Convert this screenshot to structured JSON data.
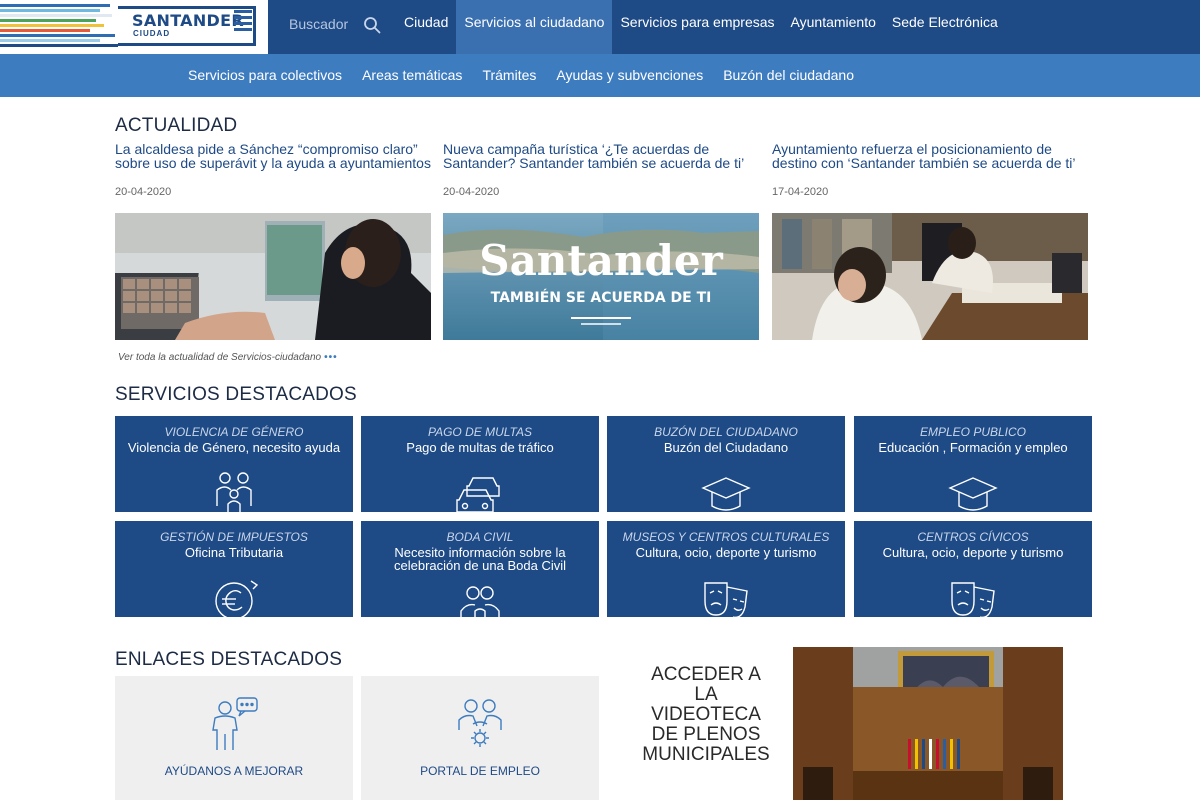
{
  "logo": {
    "name": "SANTANDER",
    "sub": "CIUDAD"
  },
  "search": {
    "label": "Buscador"
  },
  "mainnav": [
    {
      "label": "Ciudad"
    },
    {
      "label": "Servicios al ciudadano"
    },
    {
      "label": "Servicios para empresas"
    },
    {
      "label": "Ayuntamiento"
    },
    {
      "label": "Sede Electrónica"
    }
  ],
  "subnav": [
    {
      "label": "Servicios para colectivos"
    },
    {
      "label": "Areas temáticas"
    },
    {
      "label": "Trámites"
    },
    {
      "label": "Ayudas y subvenciones"
    },
    {
      "label": "Buzón del ciudadano"
    }
  ],
  "actualidad": {
    "title": "ACTUALIDAD",
    "items": [
      {
        "title": "La alcaldesa pide a Sánchez “compromiso claro” sobre uso de superávit y la ayuda a ayuntamientos",
        "date": "20-04-2020"
      },
      {
        "title": "Nueva campaña turística ‘¿Te acuerdas de Santander? Santander también se acuerda de ti’",
        "date": "20-04-2020",
        "img_title": "Santander",
        "img_sub": "TAMBIÉN SE ACUERDA DE TI"
      },
      {
        "title": "Ayuntamiento refuerza el posicionamiento de destino con ‘Santander también se acuerda de ti’",
        "date": "17-04-2020"
      }
    ],
    "see_all": "Ver toda la actualidad de Servicios-ciudadano",
    "see_all_dots": "•••"
  },
  "servicios": {
    "title": "SERVICIOS DESTACADOS",
    "items": [
      {
        "category": "VIOLENCIA DE GÉNERO",
        "desc": "Violencia de Género, necesito ayuda",
        "icon": "family-icon"
      },
      {
        "category": "PAGO DE MULTAS",
        "desc": "Pago de multas de tráfico",
        "icon": "cars-icon"
      },
      {
        "category": "BUZÓN DEL CIUDADANO",
        "desc": "Buzón del Ciudadano",
        "icon": "graduation-cap-icon"
      },
      {
        "category": "EMPLEO PUBLICO",
        "desc": "Educación , Formación y empleo",
        "icon": "graduation-cap-icon"
      },
      {
        "category": "GESTIÓN DE IMPUESTOS",
        "desc": "Oficina Tributaria",
        "icon": "euro-icon"
      },
      {
        "category": "BODA CIVIL",
        "desc": "Necesito información sobre la celebración de una Boda Civil",
        "icon": "couple-icon"
      },
      {
        "category": "MUSEOS Y CENTROS CULTURALES",
        "desc": "Cultura, ocio, deporte y turismo",
        "icon": "theater-masks-icon"
      },
      {
        "category": "CENTROS CÍVICOS",
        "desc": "Cultura, ocio, deporte y turismo",
        "icon": "theater-masks-icon"
      }
    ]
  },
  "enlaces": {
    "title": "ENLACES DESTACADOS",
    "items": [
      {
        "label": "AYÚDANOS A MEJORAR",
        "icon": "person-speech-icon"
      },
      {
        "label": "PORTAL DE EMPLEO",
        "icon": "people-gear-icon"
      }
    ]
  },
  "videoteca": {
    "label": "ACCEDER A LA VIDEOTECA DE PLENOS MUNICIPALES"
  },
  "colors": {
    "topbar": "#1e4a86",
    "subnav": "#3e7cc0",
    "active_tab": "#3a6fb0",
    "service_tile": "#1e4a86",
    "link_tile": "#efefef"
  }
}
